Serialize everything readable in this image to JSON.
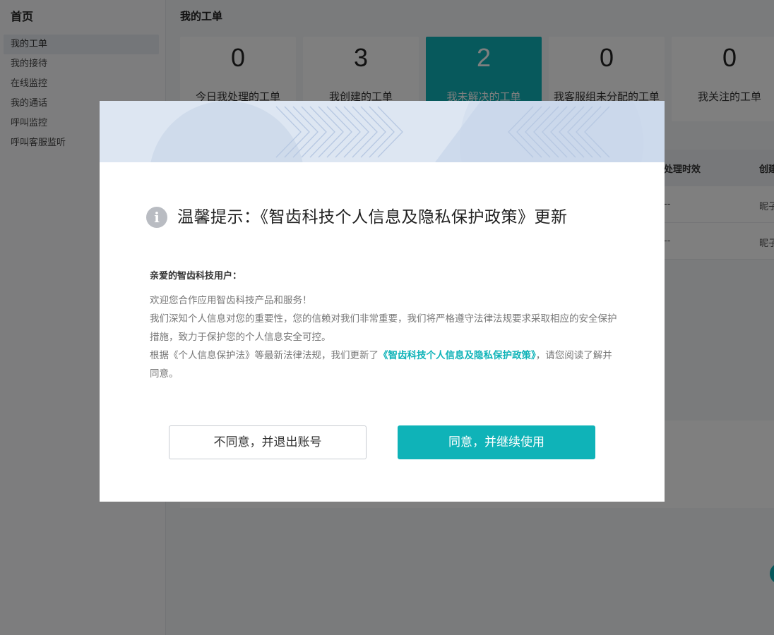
{
  "sidebar": {
    "home_label": "首页",
    "items": [
      {
        "label": "我的工单"
      },
      {
        "label": "我的接待"
      },
      {
        "label": "在线监控"
      },
      {
        "label": "我的通话"
      },
      {
        "label": "呼叫监控"
      },
      {
        "label": "呼叫客服监听"
      }
    ]
  },
  "main": {
    "page_title": "我的工单",
    "cards": [
      {
        "value": "0",
        "label": "今日我处理的工单"
      },
      {
        "value": "3",
        "label": "我创建的工单"
      },
      {
        "value": "2",
        "label": "我未解决的工单"
      },
      {
        "value": "0",
        "label": "我客服组未分配的工单"
      },
      {
        "value": "0",
        "label": "我关注的工单"
      }
    ],
    "table": {
      "headers": [
        "处理时效",
        "创建"
      ],
      "rows": [
        [
          "--",
          "昵子"
        ],
        [
          "--",
          "昵子"
        ]
      ]
    }
  },
  "modal": {
    "title": "温馨提示：《智齿科技个人信息及隐私保护政策》更新",
    "greeting": "亲爱的智齿科技用户：",
    "p1": "欢迎您合作应用智齿科技产品和服务！",
    "p2": "我们深知个人信息对您的重要性，您的信赖对我们非常重要，我们将严格遵守法律法规要求采取相应的安全保护措施，致力于保护您的个人信息安全可控。",
    "p3_before": "根据《个人信息保护法》等最新法律法规，我们更新了",
    "p3_link": "《智齿科技个人信息及隐私保护政策》",
    "p3_after": "，请您阅读了解并同意。",
    "disagree_label": "不同意，并退出账号",
    "agree_label": "同意，并继续使用",
    "info_icon_glyph": "i"
  },
  "colors": {
    "accent": "#0fb3b8",
    "overlay": "rgba(0,0,0,0.5)"
  }
}
